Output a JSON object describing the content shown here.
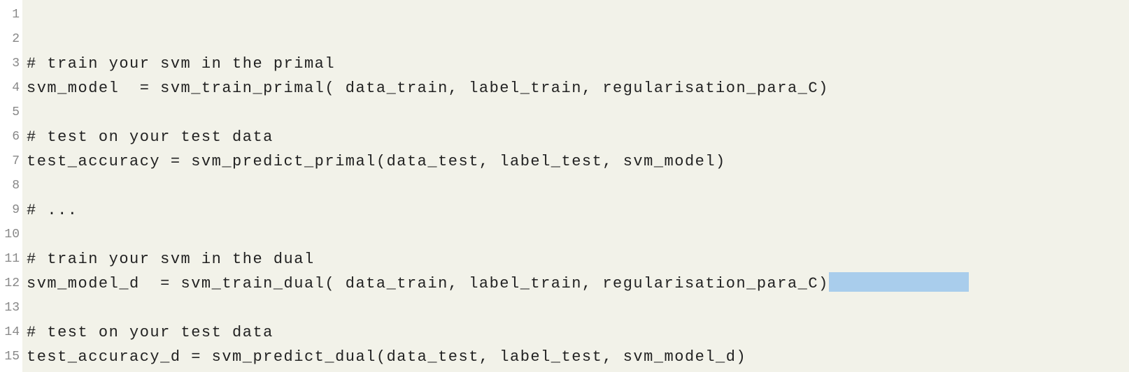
{
  "code": {
    "lines": [
      {
        "num": "1",
        "text": ""
      },
      {
        "num": "2",
        "text": ""
      },
      {
        "num": "3",
        "text": "# train your svm in the primal"
      },
      {
        "num": "4",
        "text": "svm_model  = svm_train_primal( data_train, label_train, regularisation_para_C)"
      },
      {
        "num": "5",
        "text": ""
      },
      {
        "num": "6",
        "text": "# test on your test data"
      },
      {
        "num": "7",
        "text": "test_accuracy = svm_predict_primal(data_test, label_test, svm_model)"
      },
      {
        "num": "8",
        "text": ""
      },
      {
        "num": "9",
        "text": "# ..."
      },
      {
        "num": "10",
        "text": ""
      },
      {
        "num": "11",
        "text": "# train your svm in the dual"
      },
      {
        "num": "12",
        "text": "svm_model_d  = svm_train_dual( data_train, label_train, regularisation_para_C)",
        "highlightAfter": true,
        "highlightWidth": 200
      },
      {
        "num": "13",
        "text": ""
      },
      {
        "num": "14",
        "text": "# test on your test data"
      },
      {
        "num": "15",
        "text": "test_accuracy_d = svm_predict_dual(data_test, label_test, svm_model_d)"
      }
    ]
  }
}
